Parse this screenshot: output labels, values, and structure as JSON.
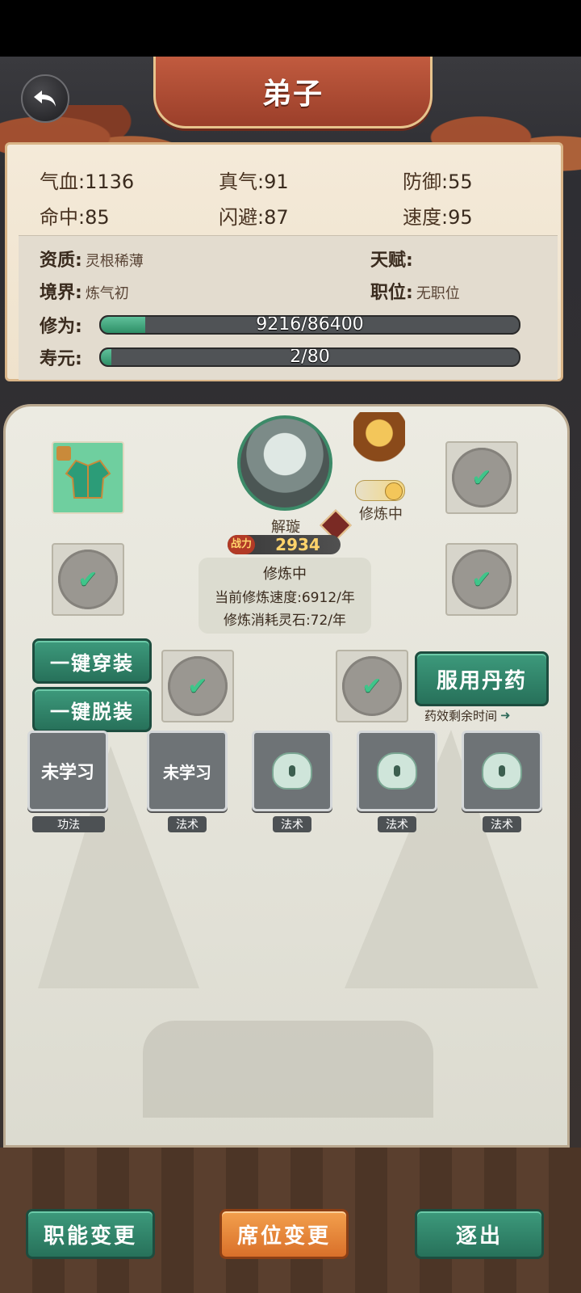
{
  "header": {
    "title": "弟子",
    "back_icon": "back-arrow-icon"
  },
  "stats": [
    {
      "label": "气血",
      "value": "1136"
    },
    {
      "label": "真气",
      "value": "91"
    },
    {
      "label": "防御",
      "value": "55"
    },
    {
      "label": "命中",
      "value": "85"
    },
    {
      "label": "闪避",
      "value": "87"
    },
    {
      "label": "速度",
      "value": "95"
    }
  ],
  "info": {
    "aptitude_label": "资质:",
    "aptitude": "灵根稀薄",
    "talent_label": "天赋:",
    "talent": "",
    "realm_label": "境界:",
    "realm": "炼气初",
    "position_label": "职位:",
    "position": "无职位"
  },
  "cultivation": {
    "label": "修为:",
    "text": "9216/86400",
    "progress": 0.107
  },
  "lifespan": {
    "label": "寿元:",
    "text": "2/80",
    "progress": 0.025
  },
  "character": {
    "name": "解璇",
    "combat_tag": "战力",
    "combat_power": "2934",
    "status": "修炼中",
    "info_title": "修炼中",
    "speed_line": "当前修炼速度:6912/年",
    "cost_line": "修炼消耗灵石:72/年"
  },
  "actions": {
    "equip_all": "一键穿装",
    "unequip_all": "一键脱装",
    "take_pill": "服用丹药",
    "pill_time": "药效剩余时间"
  },
  "skills": [
    {
      "text": "未学习",
      "tag": "功法",
      "locked": false
    },
    {
      "text": "未学习",
      "tag": "法术",
      "locked": false
    },
    {
      "text": "",
      "tag": "法术",
      "locked": true
    },
    {
      "text": "",
      "tag": "法术",
      "locked": true
    },
    {
      "text": "",
      "tag": "法术",
      "locked": true
    }
  ],
  "bottom": {
    "change_role": "职能变更",
    "change_seat": "席位变更",
    "expel": "逐出"
  },
  "colors": {
    "accent_green": "#2f8a6c",
    "accent_orange": "#e8823a",
    "banner_red": "#b14c34",
    "progress_green": "#4fb58c"
  }
}
